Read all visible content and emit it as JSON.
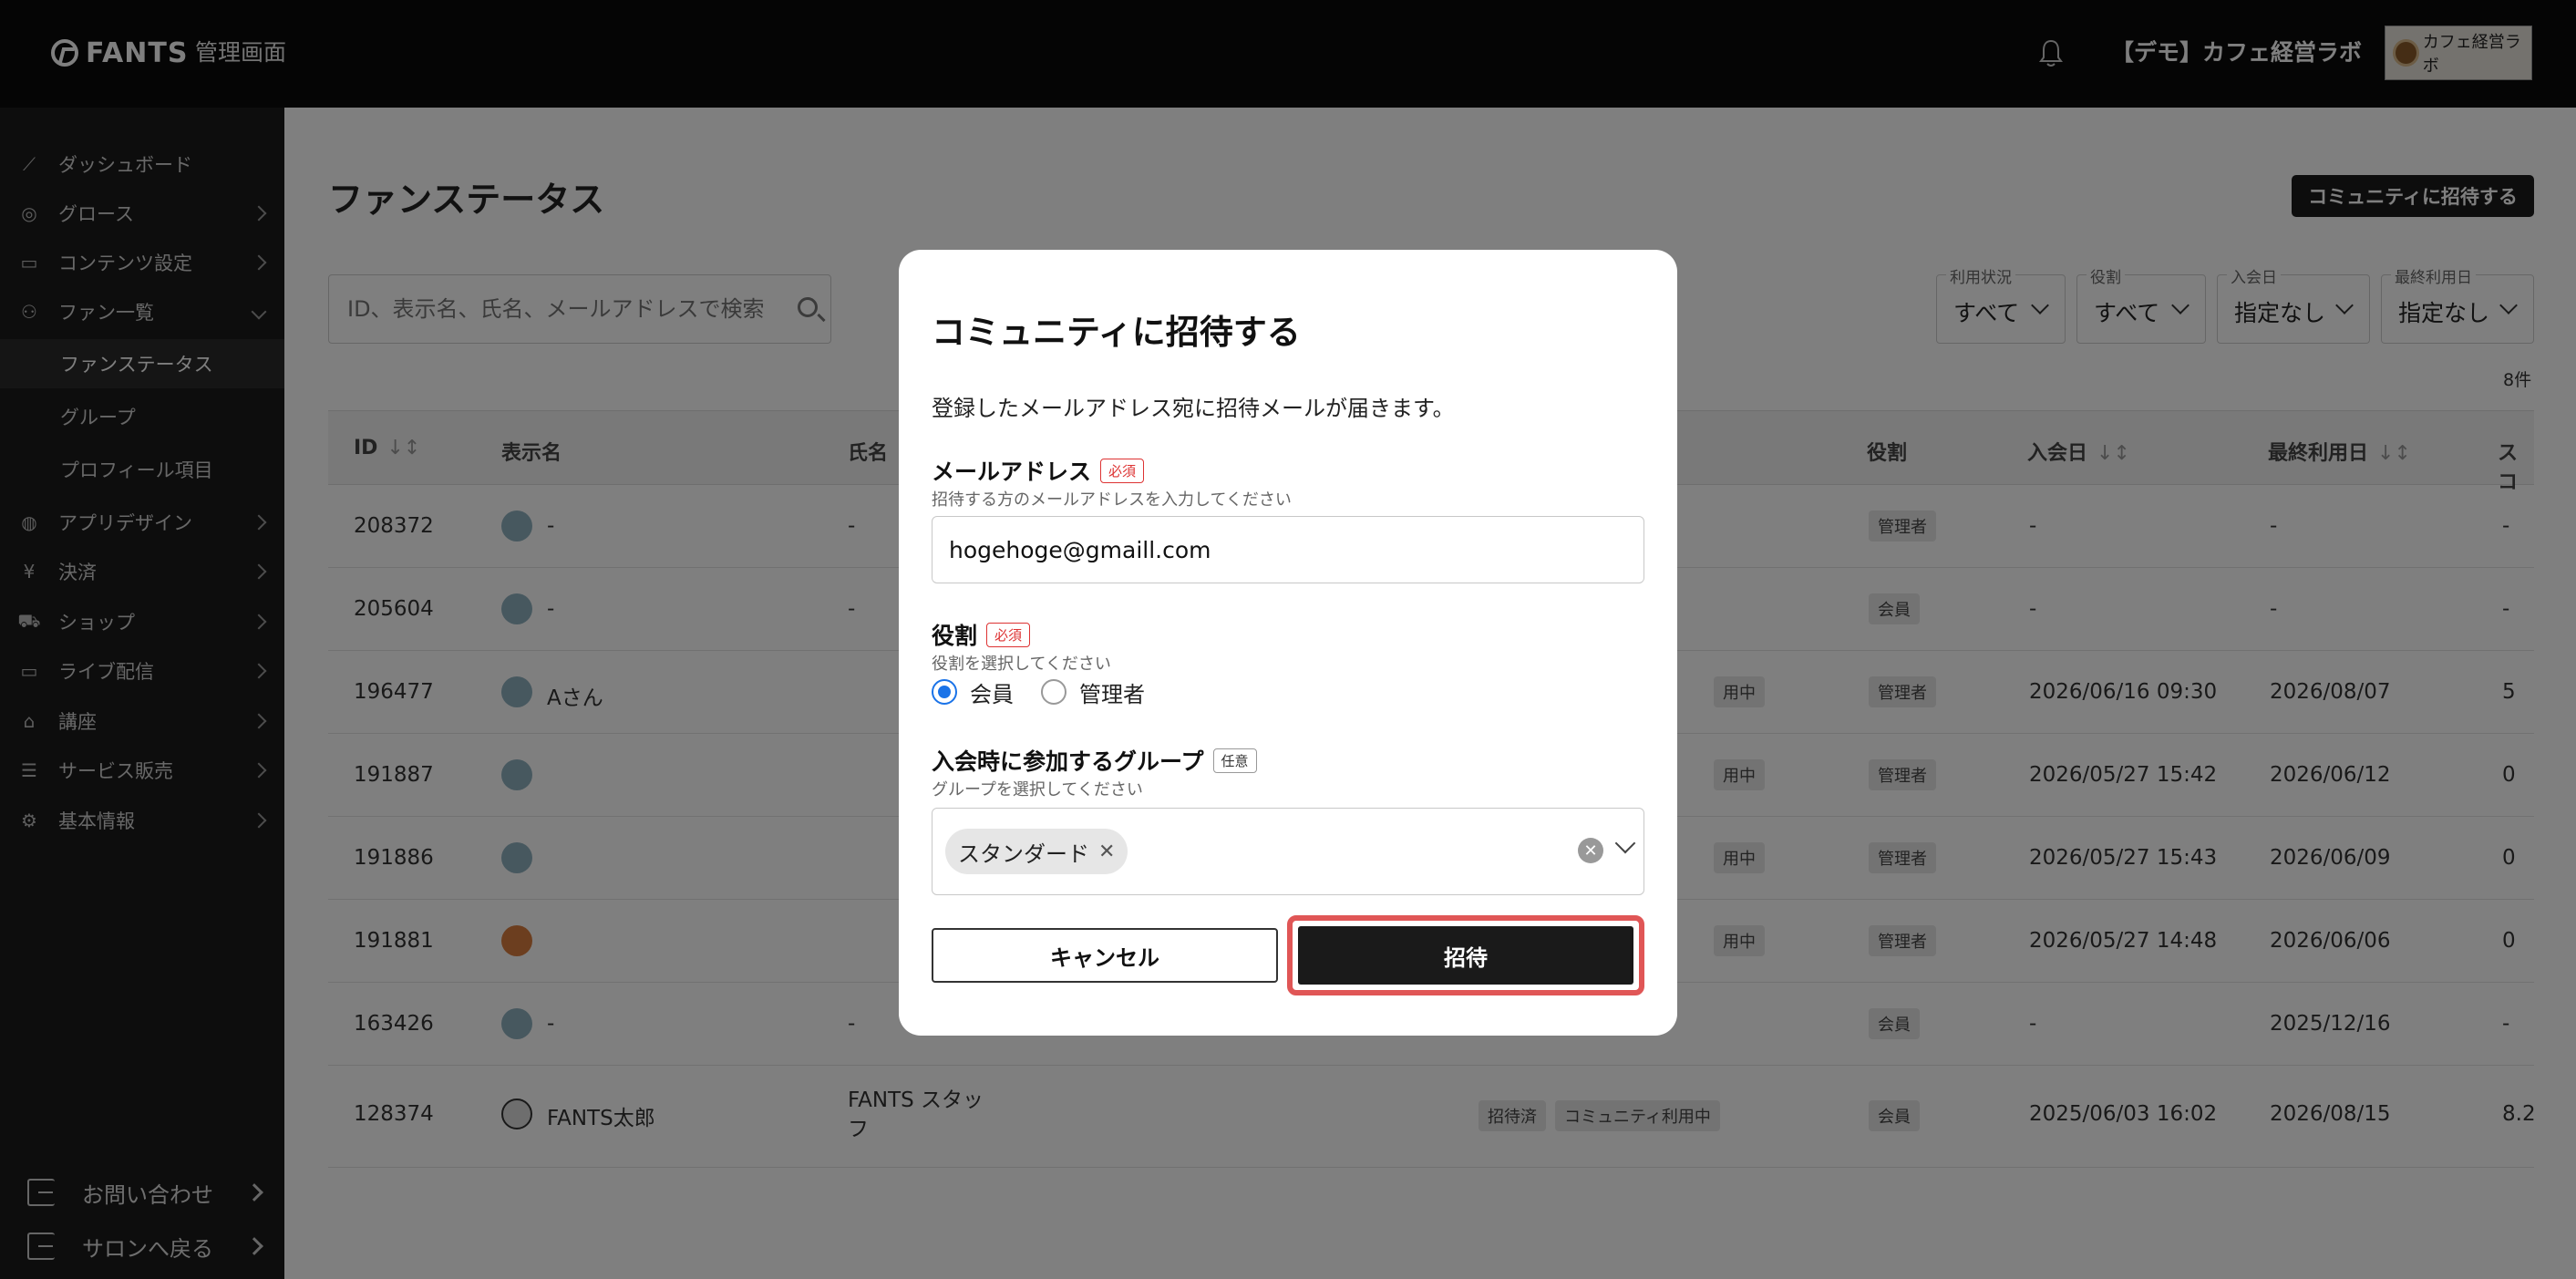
{
  "header": {
    "logo_text": "FANTS",
    "admin_title": "管理画面",
    "org_name": "【デモ】カフェ経営ラボ",
    "avatar_text": "カフェ経営ラボ"
  },
  "sidebar": {
    "items": [
      {
        "label": "ダッシュボード",
        "icon": "chart-line-icon"
      },
      {
        "label": "グロース",
        "icon": "target-icon"
      },
      {
        "label": "コンテンツ設定",
        "icon": "book-icon"
      },
      {
        "label": "ファン一覧",
        "icon": "user-icon"
      },
      {
        "label": "アプリデザイン",
        "icon": "palette-icon"
      },
      {
        "label": "決済",
        "icon": "yen-icon"
      },
      {
        "label": "ショップ",
        "icon": "cart-icon"
      },
      {
        "label": "ライブ配信",
        "icon": "video-icon"
      },
      {
        "label": "講座",
        "icon": "graduation-cap-icon"
      },
      {
        "label": "サービス販売",
        "icon": "server-icon"
      },
      {
        "label": "基本情報",
        "icon": "gear-icon"
      }
    ],
    "sub_items": [
      "ファンステータス",
      "グループ",
      "プロフィール項目"
    ],
    "bottom": [
      "お問い合わせ",
      "サロンへ戻る"
    ]
  },
  "main": {
    "page_title": "ファンステータス",
    "invite_button": "コミュニティに招待する",
    "search_placeholder": "ID、表示名、氏名、メールアドレスで検索",
    "filters": [
      {
        "label": "利用状況",
        "value": "すべて"
      },
      {
        "label": "役割",
        "value": "すべて"
      },
      {
        "label": "入会日",
        "value": "指定なし"
      },
      {
        "label": "最終利用日",
        "value": "指定なし"
      }
    ],
    "count": "8件",
    "columns": [
      "ID",
      "表示名",
      "氏名",
      "役割",
      "入会日",
      "最終利用日",
      "スコ"
    ],
    "rows": [
      {
        "id": "208372",
        "display": "-",
        "name": "-",
        "role": "管理者",
        "joined": "-",
        "last": "-",
        "score": "-",
        "tags": []
      },
      {
        "id": "205604",
        "display": "-",
        "name": "-",
        "role": "会員",
        "joined": "-",
        "last": "-",
        "score": "-",
        "tags": []
      },
      {
        "id": "196477",
        "display": "Aさん",
        "name": "",
        "role": "管理者",
        "joined": "2026/06/16 09:30",
        "last": "2026/08/07",
        "score": "5",
        "tags": [
          "用中"
        ]
      },
      {
        "id": "191887",
        "display": "",
        "name": "",
        "role": "管理者",
        "joined": "2026/05/27 15:42",
        "last": "2026/06/12",
        "score": "0",
        "tags": [
          "用中"
        ]
      },
      {
        "id": "191886",
        "display": "",
        "name": "",
        "role": "管理者",
        "joined": "2026/05/27 15:43",
        "last": "2026/06/09",
        "score": "0",
        "tags": [
          "用中"
        ]
      },
      {
        "id": "191881",
        "display": "",
        "name": "",
        "role": "管理者",
        "joined": "2026/05/27 14:48",
        "last": "2026/06/06",
        "score": "0",
        "tags": [
          "用中"
        ]
      },
      {
        "id": "163426",
        "display": "-",
        "name": "-",
        "role": "会員",
        "joined": "-",
        "last": "2025/12/16",
        "score": "-",
        "tags": []
      },
      {
        "id": "128374",
        "display": "FANTS太郎",
        "name": "FANTS スタッフ",
        "role": "会員",
        "joined": "2025/06/03 16:02",
        "last": "2026/08/15",
        "score": "8.2",
        "tags": [
          "招待済",
          "コミュニティ利用中"
        ]
      }
    ]
  },
  "modal": {
    "title": "コミュニティに招待する",
    "description": "登録したメールアドレス宛に招待メールが届きます。",
    "email_label": "メールアドレス",
    "required_badge": "必須",
    "optional_badge": "任意",
    "email_help": "招待する方のメールアドレスを入力してください",
    "email_value": "hogehoge@gmaill.com",
    "role_label": "役割",
    "role_help": "役割を選択してください",
    "role_options": [
      "会員",
      "管理者"
    ],
    "role_selected": "会員",
    "group_label": "入会時に参加するグループ",
    "group_help": "グループを選択してください",
    "group_chip": "スタンダード",
    "cancel": "キャンセル",
    "invite": "招待"
  }
}
